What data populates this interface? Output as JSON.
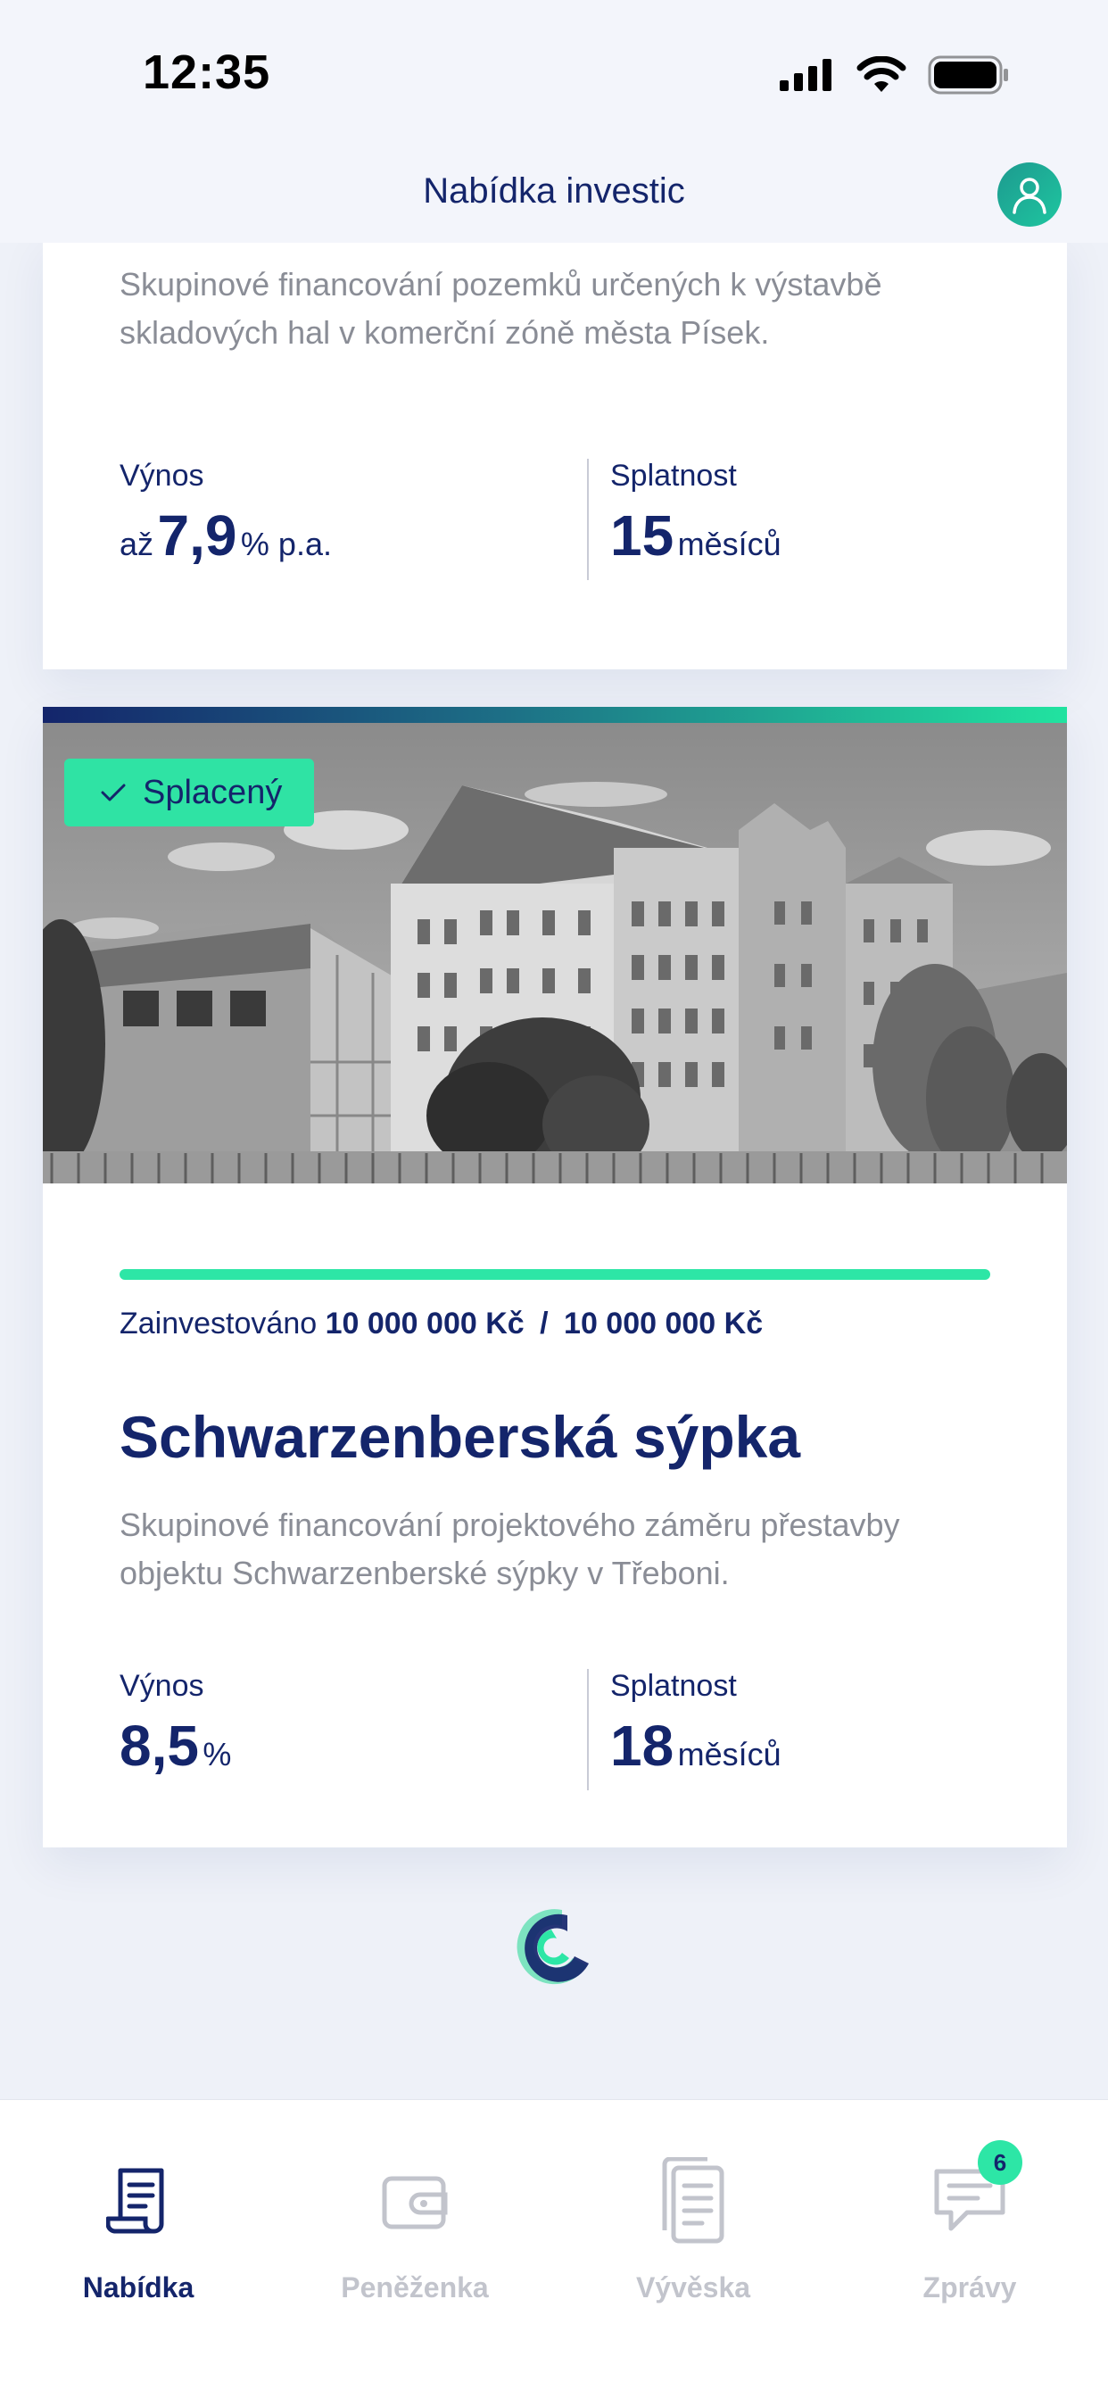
{
  "status_bar": {
    "time": "12:35",
    "icons": [
      "cellular-signal-icon",
      "wifi-icon",
      "battery-icon"
    ]
  },
  "header": {
    "title": "Nabídka investic",
    "avatar_icon": "user-avatar-icon"
  },
  "offers": [
    {
      "description": "Skupinové financování pozemků určených k výstavbě skladových hal v komerční zóně města Písek.",
      "yield_label": "Výnos",
      "yield_prefix": "až",
      "yield_value": "7,9",
      "yield_unit": "% p.a.",
      "maturity_label": "Splatnost",
      "maturity_value": "15",
      "maturity_unit": "měsíců"
    },
    {
      "status_badge": "Splacený",
      "status_icon": "checkmark-icon",
      "image": "grayscale photo of a historic multi-storey granary building with a red-roofed tower, trees and a fence",
      "progress_fraction": 1.0,
      "invested_label": "Zainvestováno",
      "invested_amount": "10 000 000 Kč",
      "invested_separator": "/",
      "target_amount": "10 000 000 Kč",
      "title": "Schwarzenberská sýpka",
      "description": "Skupinové financování projektového záměru přestavby objektu Schwarzenberské sýpky v Třeboni.",
      "yield_label": "Výnos",
      "yield_value": "8,5",
      "yield_unit": "%",
      "maturity_label": "Splatnost",
      "maturity_value": "18",
      "maturity_unit": "měsíců"
    }
  ],
  "footer_logo": "app-logo-icon",
  "tabbar": {
    "items": [
      {
        "label": "Nabídka",
        "icon": "document-scroll-icon",
        "active": true
      },
      {
        "label": "Peněženka",
        "icon": "wallet-icon",
        "active": false
      },
      {
        "label": "Vývěska",
        "icon": "documents-icon",
        "active": false
      },
      {
        "label": "Zprávy",
        "icon": "chat-bubble-icon",
        "active": false,
        "badge": "6"
      }
    ]
  },
  "colors": {
    "primary": "#14256b",
    "accent": "#2de6a6",
    "muted_text": "#8a8d96",
    "background": "#eef1f8"
  }
}
